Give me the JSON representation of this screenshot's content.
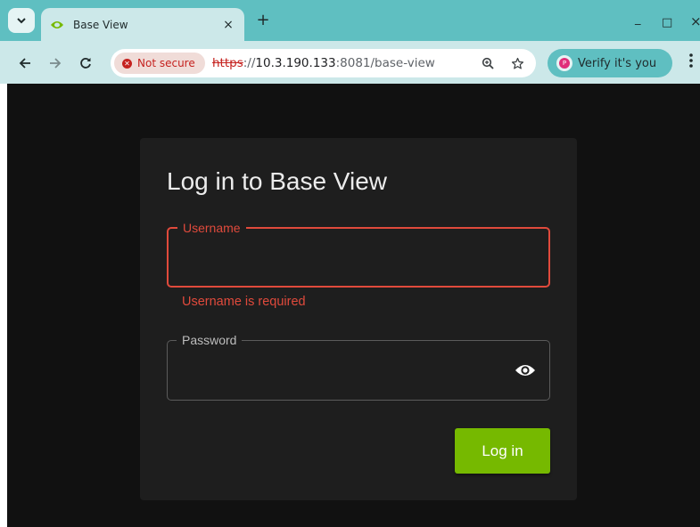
{
  "browser": {
    "tab_title": "Base View",
    "tab_close_glyph": "×",
    "new_tab_glyph": "+",
    "minimize_glyph": "_",
    "maximize_glyph": "□",
    "close_glyph": "×",
    "security_label": "Not secure",
    "url_scheme": "https",
    "url_sep": "://",
    "url_host": "10.3.190.133",
    "url_rest": ":8081/base-view",
    "verify_label": "Verify it's you",
    "verify_initial": "P"
  },
  "icons": {
    "tab_search": "chevron-down-icon",
    "favicon": "nvidia-icon",
    "back": "arrow-left-icon",
    "forward": "arrow-right-icon",
    "reload": "reload-icon",
    "security": "warning-icon",
    "zoom": "zoom-icon",
    "bookmark": "star-icon",
    "menu": "kebab-menu-icon",
    "password_toggle": "eye-icon"
  },
  "login": {
    "title": "Log in to Base View",
    "username_label": "Username",
    "username_value": "",
    "username_error": "Username is required",
    "password_label": "Password",
    "password_value": "",
    "submit_label": "Log in"
  },
  "colors": {
    "accent": "#76b900",
    "error": "#e04a3c",
    "browser_frame": "#5fbfc1",
    "page_background": "#111111",
    "card_background": "#1e1e1e"
  }
}
